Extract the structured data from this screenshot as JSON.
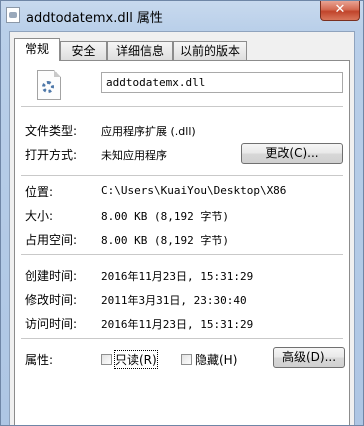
{
  "window": {
    "title": "addtodatemx.dll 属性",
    "close_label": "✕"
  },
  "tabs": [
    {
      "label": "常规",
      "active": true
    },
    {
      "label": "安全",
      "active": false
    },
    {
      "label": "详细信息",
      "active": false
    },
    {
      "label": "以前的版本",
      "active": false
    }
  ],
  "general": {
    "file_name": "addtodatemx.dll",
    "file_type_label": "文件类型:",
    "file_type_value": "应用程序扩展 (.dll)",
    "opens_with_label": "打开方式:",
    "opens_with_value": "未知应用程序",
    "change_button": "更改(C)...",
    "location_label": "位置:",
    "location_value": "C:\\Users\\KuaiYou\\Desktop\\X86",
    "size_label": "大小:",
    "size_value": "8.00 KB (8,192 字节)",
    "size_on_disk_label": "占用空间:",
    "size_on_disk_value": "8.00 KB (8,192 字节)",
    "created_label": "创建时间:",
    "created_value": "2016年11月23日, 15:31:29",
    "modified_label": "修改时间:",
    "modified_value": "2011年3月31日, 23:30:40",
    "accessed_label": "访问时间:",
    "accessed_value": "2016年11月23日, 15:31:29",
    "attributes_label": "属性:",
    "readonly_label": "只读(R)",
    "readonly_checked": false,
    "hidden_label": "隐藏(H)",
    "hidden_checked": false,
    "advanced_button": "高级(D)..."
  },
  "icons": {
    "title_icon": "dll-file-icon",
    "file_icon": "dll-file-gear-icon"
  }
}
